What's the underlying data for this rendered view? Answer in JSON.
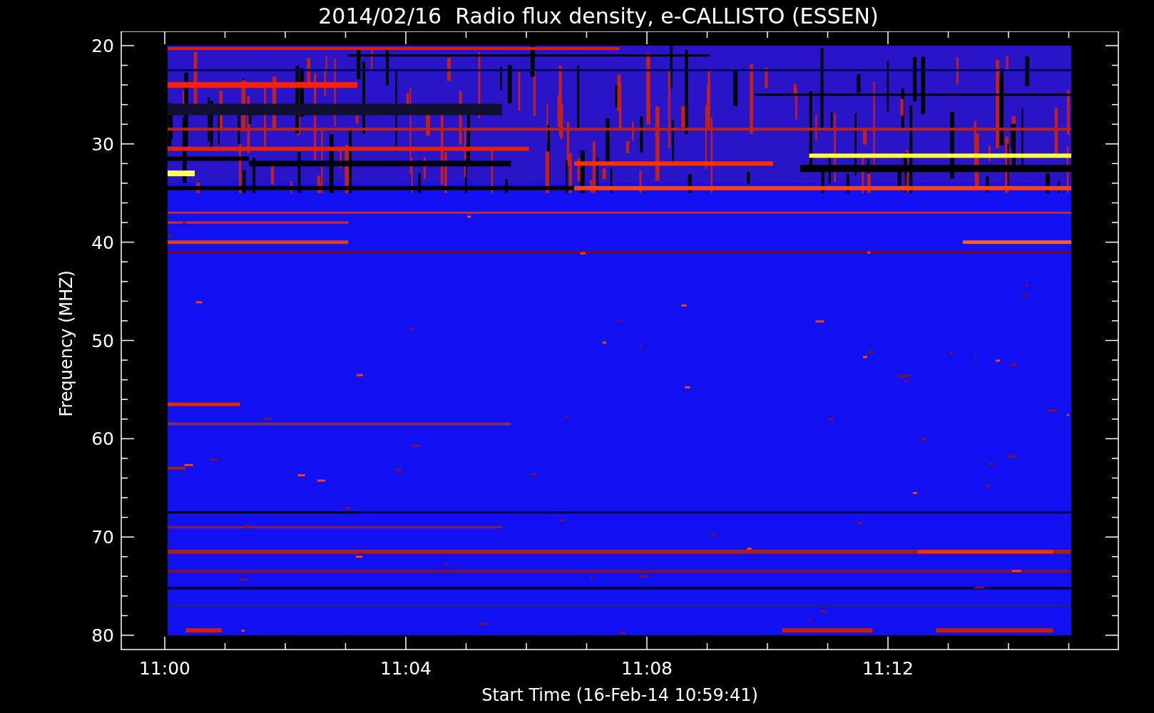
{
  "title": "2014/02/16  Radio flux density, e-CALLISTO (ESSEN)",
  "y_axis": {
    "label": "Frequency (MHZ)",
    "ticks": [
      "20",
      "30",
      "40",
      "50",
      "60",
      "70",
      "80"
    ]
  },
  "x_axis": {
    "label": "Start Time (16-Feb-14 10:59:41)",
    "ticks": [
      "11:00",
      "11:04",
      "11:08",
      "11:12"
    ]
  }
}
